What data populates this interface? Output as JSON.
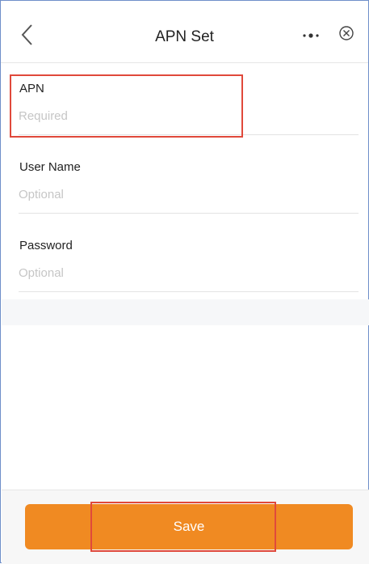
{
  "header": {
    "title": "APN Set",
    "back_icon": "chevron-left-icon",
    "more_icon": "more-dots-icon",
    "close_icon": "close-circle-icon"
  },
  "form": {
    "fields": [
      {
        "label": "APN",
        "placeholder": "Required",
        "value": ""
      },
      {
        "label": "User Name",
        "placeholder": "Optional",
        "value": ""
      },
      {
        "label": "Password",
        "placeholder": "Optional",
        "value": ""
      }
    ]
  },
  "footer": {
    "save_label": "Save"
  },
  "colors": {
    "accent": "#f08a22",
    "highlight": "#e0493b",
    "frame_border": "#6f8fc9"
  }
}
